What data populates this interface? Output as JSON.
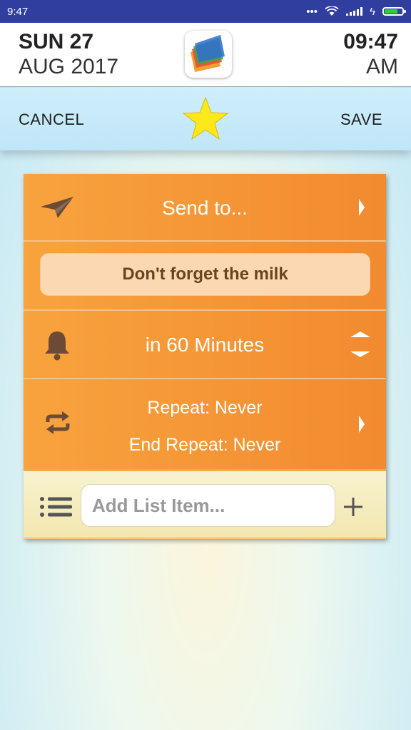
{
  "status_bar": {
    "time": "9:47"
  },
  "header": {
    "day": "SUN 27",
    "month_year": "AUG 2017",
    "time": "09:47",
    "ampm": "AM"
  },
  "actions": {
    "cancel_label": "CANCEL",
    "save_label": "SAVE"
  },
  "card": {
    "send_to_label": "Send to...",
    "note_text": "Don't forget the milk",
    "reminder_text": "in 60 Minutes",
    "repeat_text": "Repeat: Never",
    "end_repeat_text": "End Repeat: Never",
    "list_placeholder": "Add List Item..."
  },
  "colors": {
    "accent_orange": "#f5943a",
    "star_yellow": "#ffe81a",
    "status_bar": "#303f9f"
  },
  "icons": [
    "send-icon",
    "chevron-right-icon",
    "bell-icon",
    "up-down-arrows-icon",
    "repeat-icon",
    "list-icon",
    "plus-icon",
    "star-icon",
    "app-logo"
  ]
}
